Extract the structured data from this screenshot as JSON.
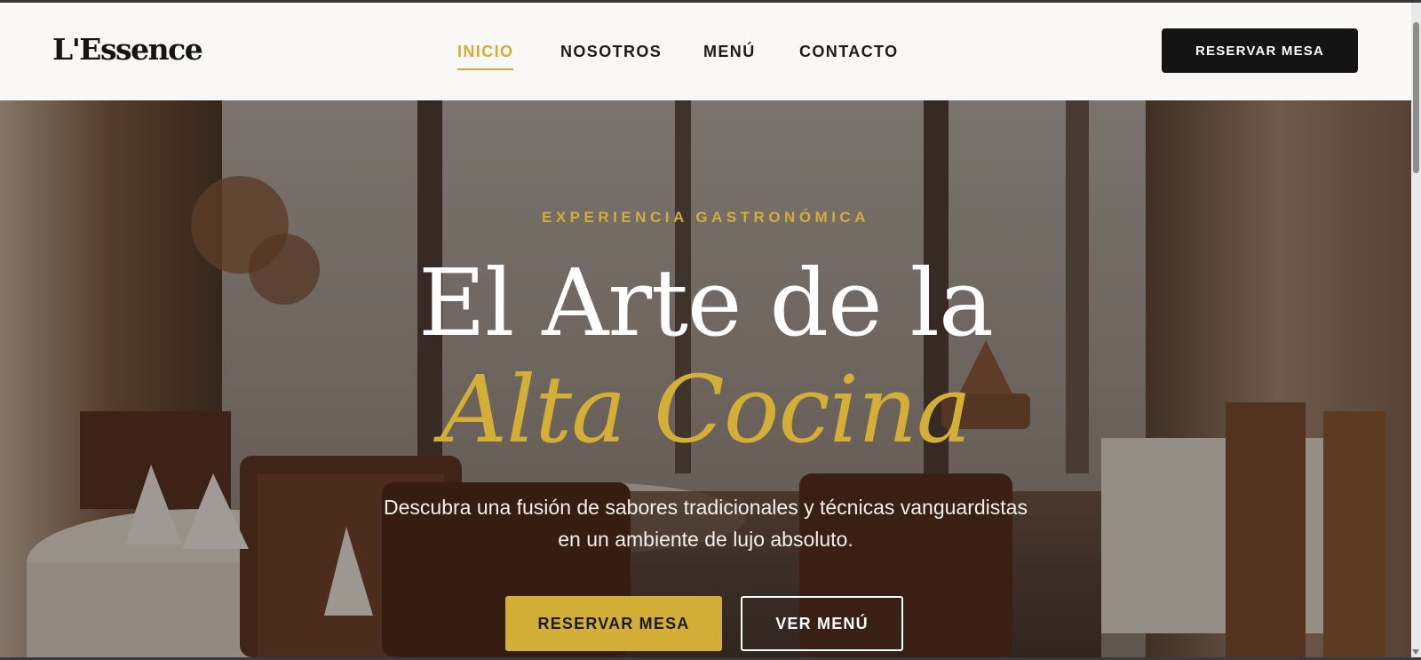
{
  "brand": {
    "name": "L'Essence"
  },
  "nav": {
    "items": [
      {
        "label": "INICIO",
        "active": true
      },
      {
        "label": "NOSOTROS",
        "active": false
      },
      {
        "label": "MENÚ",
        "active": false
      },
      {
        "label": "CONTACTO",
        "active": false
      }
    ]
  },
  "header": {
    "cta_label": "RESERVAR MESA"
  },
  "hero": {
    "eyebrow": "EXPERIENCIA GASTRONÓMICA",
    "title_line1": "El Arte de la",
    "title_line2": "Alta Cocina",
    "subtitle_line1": "Descubra una fusión de sabores tradicionales y técnicas vanguardistas",
    "subtitle_line2": "en un ambiente de lujo absoluto.",
    "primary_button": "RESERVAR MESA",
    "secondary_button": "VER MENÚ"
  },
  "colors": {
    "accent": "#d4af37",
    "dark": "#141414",
    "header_bg": "#f9f8f6"
  },
  "icons": {
    "scroll_down": "chevron-down-icon"
  }
}
